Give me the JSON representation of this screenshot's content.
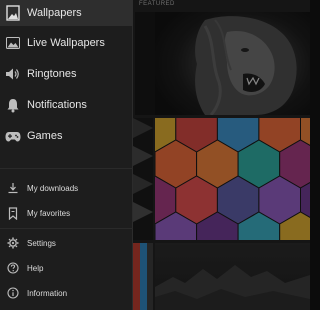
{
  "drawer": {
    "primary_items": [
      {
        "label": "Wallpapers",
        "icon": "image-icon",
        "active": true
      },
      {
        "label": "Live Wallpapers",
        "icon": "landscape-icon",
        "active": false
      },
      {
        "label": "Ringtones",
        "icon": "speaker-icon",
        "active": false
      },
      {
        "label": "Notifications",
        "icon": "bell-icon",
        "active": false
      },
      {
        "label": "Games",
        "icon": "gamepad-icon",
        "active": false
      }
    ],
    "library_items": [
      {
        "label": "My downloads",
        "icon": "download-icon"
      },
      {
        "label": "My favorites",
        "icon": "bookmark-icon"
      }
    ],
    "settings_items": [
      {
        "label": "Settings",
        "icon": "gear-icon"
      },
      {
        "label": "Help",
        "icon": "help-icon"
      },
      {
        "label": "Information",
        "icon": "info-icon"
      }
    ]
  },
  "content": {
    "section_label": "FEATURED"
  },
  "colors": {
    "drawer_bg": "#1d1d1d",
    "active_item_bg": "#2e2e2e",
    "text": "#e6e6e6",
    "icon": "#bdbdbd"
  },
  "hex_palette": [
    "#2ea59b",
    "#d3a531",
    "#d94d4d",
    "#3d8cc2",
    "#8a5ab8",
    "#e07b3a",
    "#3aa5b8",
    "#9b3a7a",
    "#c8463f",
    "#5a5a9e",
    "#e0673a",
    "#6a3a8a"
  ]
}
